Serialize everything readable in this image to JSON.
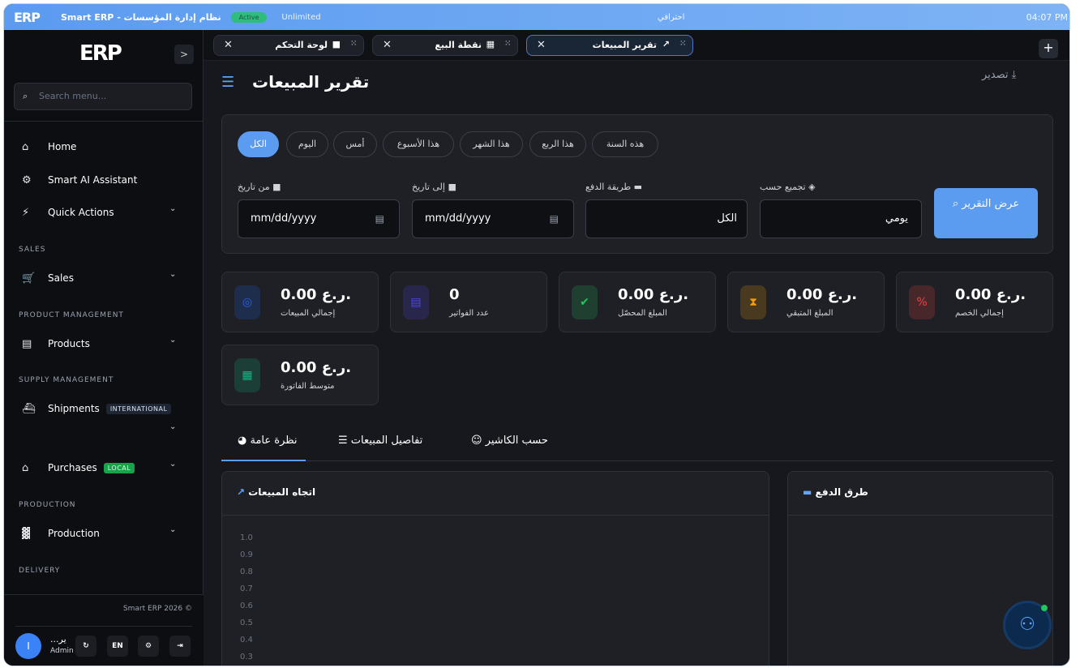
{
  "topbar": {
    "logo": "ERP",
    "app_name": "Smart ERP - نظام إدارة المؤسسات",
    "plan_badge": "Active",
    "plan": "Unlimited",
    "center_text": "احترافي",
    "time": "04:07 PM"
  },
  "sidebar": {
    "logo": "ERP",
    "toggle": ">",
    "search_placeholder": "Search menu...",
    "items": {
      "home": "Home",
      "ai": "Smart AI Assistant",
      "quick": "Quick Actions",
      "sales": "Sales",
      "products": "Products",
      "shipments": "Shipments",
      "purchases": "Purchases",
      "production": "Production"
    },
    "sections": {
      "sales": "SALES",
      "product": "PRODUCT MANAGEMENT",
      "supply": "SUPPLY MANAGEMENT",
      "production": "PRODUCTION",
      "delivery": "DELIVERY"
    },
    "badges": {
      "international": "INTERNATIONAL",
      "local": "LOCAL"
    },
    "copyright": "Smart ERP 2026 ©",
    "user": {
      "initial": "I",
      "name": "...ير",
      "role": "Admin"
    },
    "footer_buttons": {
      "lang": "EN"
    }
  },
  "tabs": [
    {
      "label": "لوحة التحكم"
    },
    {
      "label": "نقطة البيع"
    },
    {
      "label": "تقرير المبيعات"
    }
  ],
  "page": {
    "title": "تقرير المبيعات",
    "export": "تصدير"
  },
  "filters": {
    "chips": [
      "هذه السنة",
      "هذا الربع",
      "هذا الشهر",
      "هذا الأسبوع",
      "أمس",
      "اليوم",
      "الكل"
    ],
    "labels": {
      "group_by": "تجميع حسب",
      "payment_method": "طريقة الدفع",
      "to_date": "إلى تاريخ",
      "from_date": "من تاريخ"
    },
    "values": {
      "group_by": "يومي",
      "payment_method": "الكل",
      "date_placeholder": "mm/dd/yyyy"
    },
    "show_report": "عرض التقرير"
  },
  "stats": [
    {
      "value": "0.00 ر.ع.",
      "label": "إجمالي المبيعات",
      "color": "#2563eb"
    },
    {
      "value": "0",
      "label": "عدد الفواتير",
      "color": "#4f46e5"
    },
    {
      "value": "0.00 ر.ع.",
      "label": "المبلغ المحصّل",
      "color": "#22c55e"
    },
    {
      "value": "0.00 ر.ع.",
      "label": "المبلغ المتبقي",
      "color": "#f59e0b"
    },
    {
      "value": "0.00 ر.ع.",
      "label": "إجمالي الخصم",
      "color": "#ef4444"
    },
    {
      "value": "0.00 ر.ع.",
      "label": "متوسط الفاتورة",
      "color": "#10b981"
    }
  ],
  "content_tabs": {
    "overview": "نظرة عامة",
    "details": "تفاصيل المبيعات",
    "by_cashier": "حسب الكاشير"
  },
  "panels": {
    "trend": "اتجاه المبيعات",
    "payments": "طرق الدفع"
  },
  "y_ticks": [
    "1.0",
    "0.9",
    "0.8",
    "0.7",
    "0.6",
    "0.5",
    "0.4",
    "0.3"
  ]
}
